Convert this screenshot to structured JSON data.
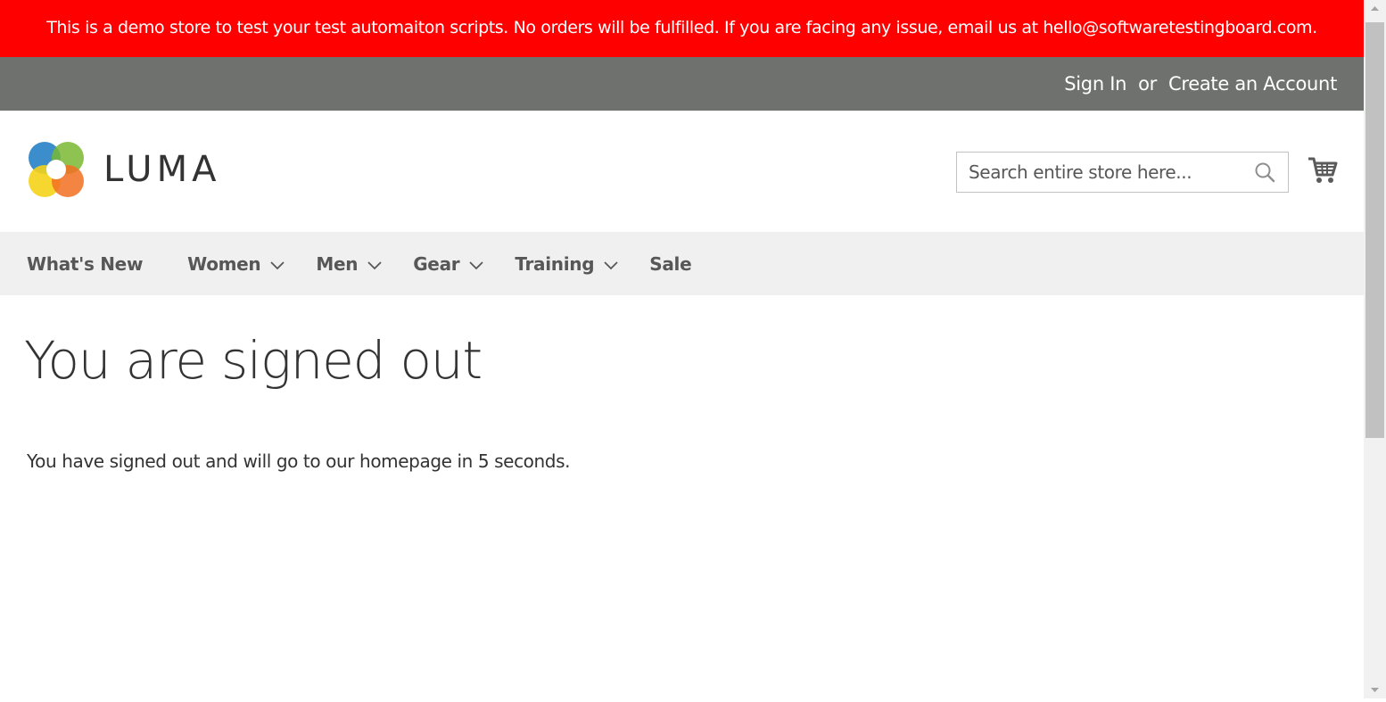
{
  "banner": {
    "text": "This is a demo store to test your test automaiton scripts. No orders will be fulfilled. If you are facing any issue, email us at hello@softwaretestingboard.com."
  },
  "panel": {
    "sign_in": "Sign In",
    "or": "or",
    "create_account": "Create an Account"
  },
  "header": {
    "logo_text": "LUMA",
    "search_placeholder": "Search entire store here...",
    "search_icon": "search-icon",
    "cart_icon": "shopping-cart-icon"
  },
  "nav": {
    "items": [
      {
        "label": "What's New",
        "has_dropdown": false
      },
      {
        "label": "Women",
        "has_dropdown": true
      },
      {
        "label": "Men",
        "has_dropdown": true
      },
      {
        "label": "Gear",
        "has_dropdown": true
      },
      {
        "label": "Training",
        "has_dropdown": true
      },
      {
        "label": "Sale",
        "has_dropdown": false
      }
    ]
  },
  "main": {
    "title": "You are signed out",
    "message": "You have signed out and will go to our homepage in 5 seconds."
  },
  "colors": {
    "banner_bg": "#ff0000",
    "panel_bg": "#6e716e",
    "nav_bg": "#f0f0f0",
    "text": "#333333"
  }
}
